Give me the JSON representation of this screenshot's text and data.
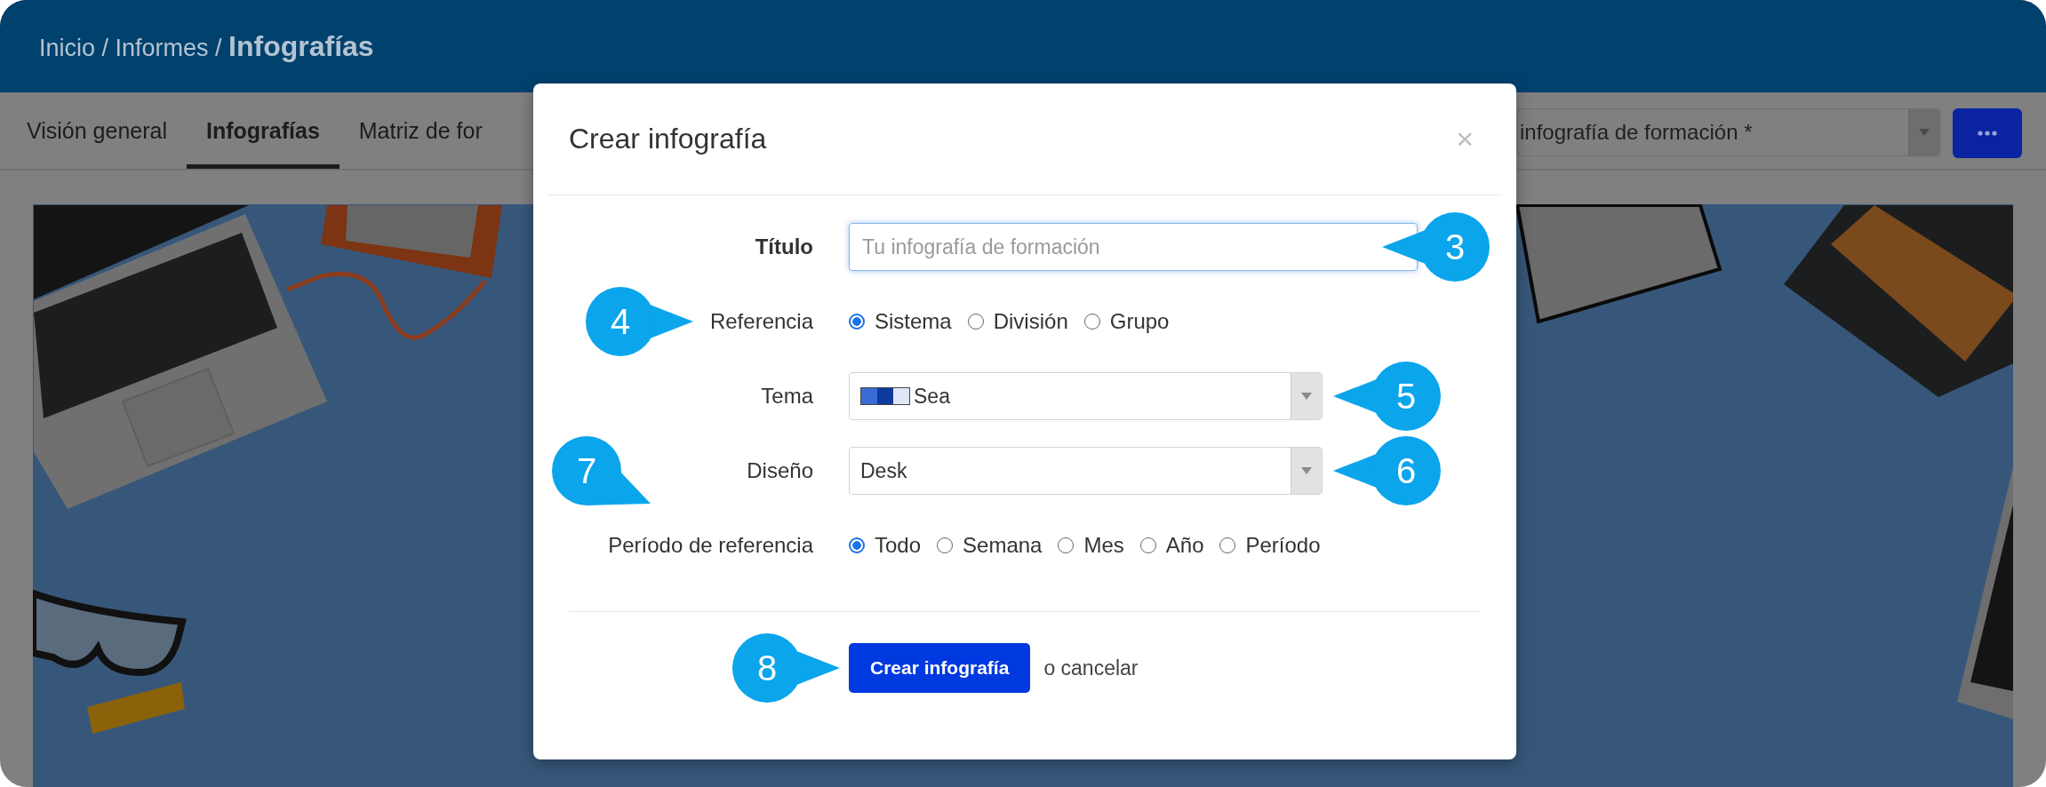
{
  "breadcrumb": "Inicio / Informes / **Infografías**",
  "tabs": [
    {
      "label": "Visión general",
      "selected": false
    },
    {
      "label": "Infografías",
      "selected": true
    },
    {
      "label": "Matriz de for",
      "selected": false
    }
  ],
  "template_select": {
    "value": "infografía de formación *"
  },
  "dialog": {
    "title": "Crear infografía",
    "close": "×",
    "fields": [
      {
        "label": "Título",
        "bold": true,
        "kind": "text",
        "placeholder": "Tu infografía de formación",
        "callout": {
          "number": "3",
          "kind": "left"
        }
      },
      {
        "label": "Referencia",
        "bold": false,
        "kind": "radio",
        "options": [
          {
            "label": "Sistema",
            "selected": true
          },
          {
            "label": "División",
            "selected": false
          },
          {
            "label": "Grupo",
            "selected": false
          }
        ],
        "callout": {
          "number": "4",
          "kind": "right"
        }
      },
      {
        "label": "Tema",
        "bold": false,
        "kind": "select",
        "value": "Sea",
        "swatches": [
          {
            "color": "#3a6bd6"
          },
          {
            "color": "#0d3a9c"
          },
          {
            "color": "#dfe7f7"
          }
        ],
        "callout": {
          "number": "5",
          "kind": "left"
        }
      },
      {
        "label": "Diseño",
        "bold": false,
        "kind": "select",
        "value": "Desk",
        "callout": {
          "number": "6",
          "kind": "left"
        }
      },
      {
        "label": "Período de referencia",
        "bold": false,
        "kind": "radio",
        "options": [
          {
            "label": "Todo",
            "selected": true
          },
          {
            "label": "Semana",
            "selected": false
          },
          {
            "label": "Mes",
            "selected": false
          },
          {
            "label": "Año",
            "selected": false
          },
          {
            "label": "Período",
            "selected": false
          }
        ],
        "callout": {
          "number": "7",
          "kind": "diagonal"
        }
      }
    ],
    "submit": {
      "label": "Crear infografía",
      "callout": {
        "number": "8",
        "kind": "right"
      }
    },
    "cancel": "o cancelar"
  }
}
